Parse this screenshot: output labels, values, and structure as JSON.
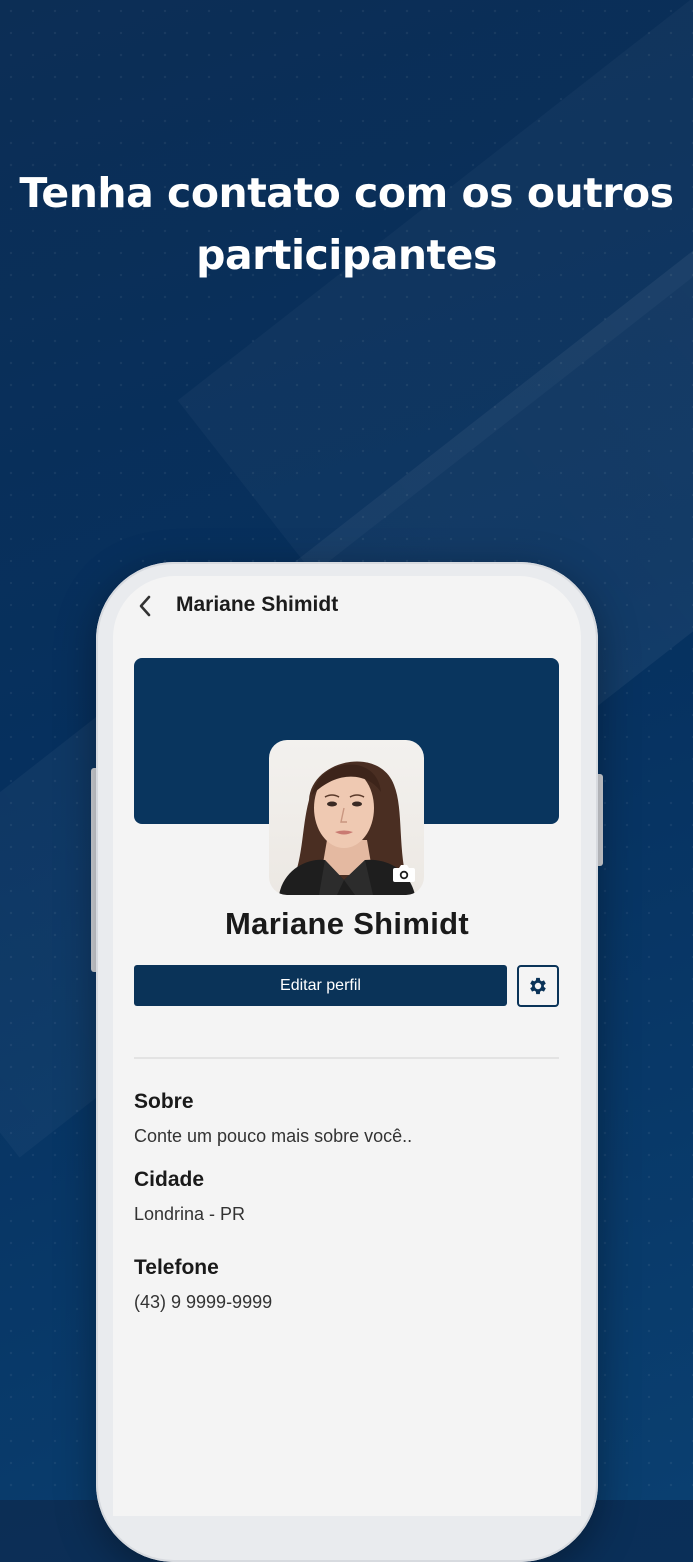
{
  "headline": "Tenha contato com os outros participantes",
  "topbar": {
    "title": "Mariane Shimidt",
    "back_icon": "chevron-left-icon"
  },
  "profile": {
    "name": "Mariane Shimidt",
    "cover_color": "#09355e",
    "camera_icon": "camera-icon"
  },
  "actions": {
    "edit_label": "Editar perfil",
    "settings_icon": "gear-icon"
  },
  "sections": [
    {
      "label": "Sobre",
      "value": "Conte um pouco mais sobre você.."
    },
    {
      "label": "Cidade",
      "value": "Londrina - PR"
    },
    {
      "label": "Telefone",
      "value": "(43) 9 9999-9999"
    }
  ],
  "colors": {
    "background": "#06305e",
    "accent": "#0a3358",
    "screen": "#f4f4f4"
  }
}
